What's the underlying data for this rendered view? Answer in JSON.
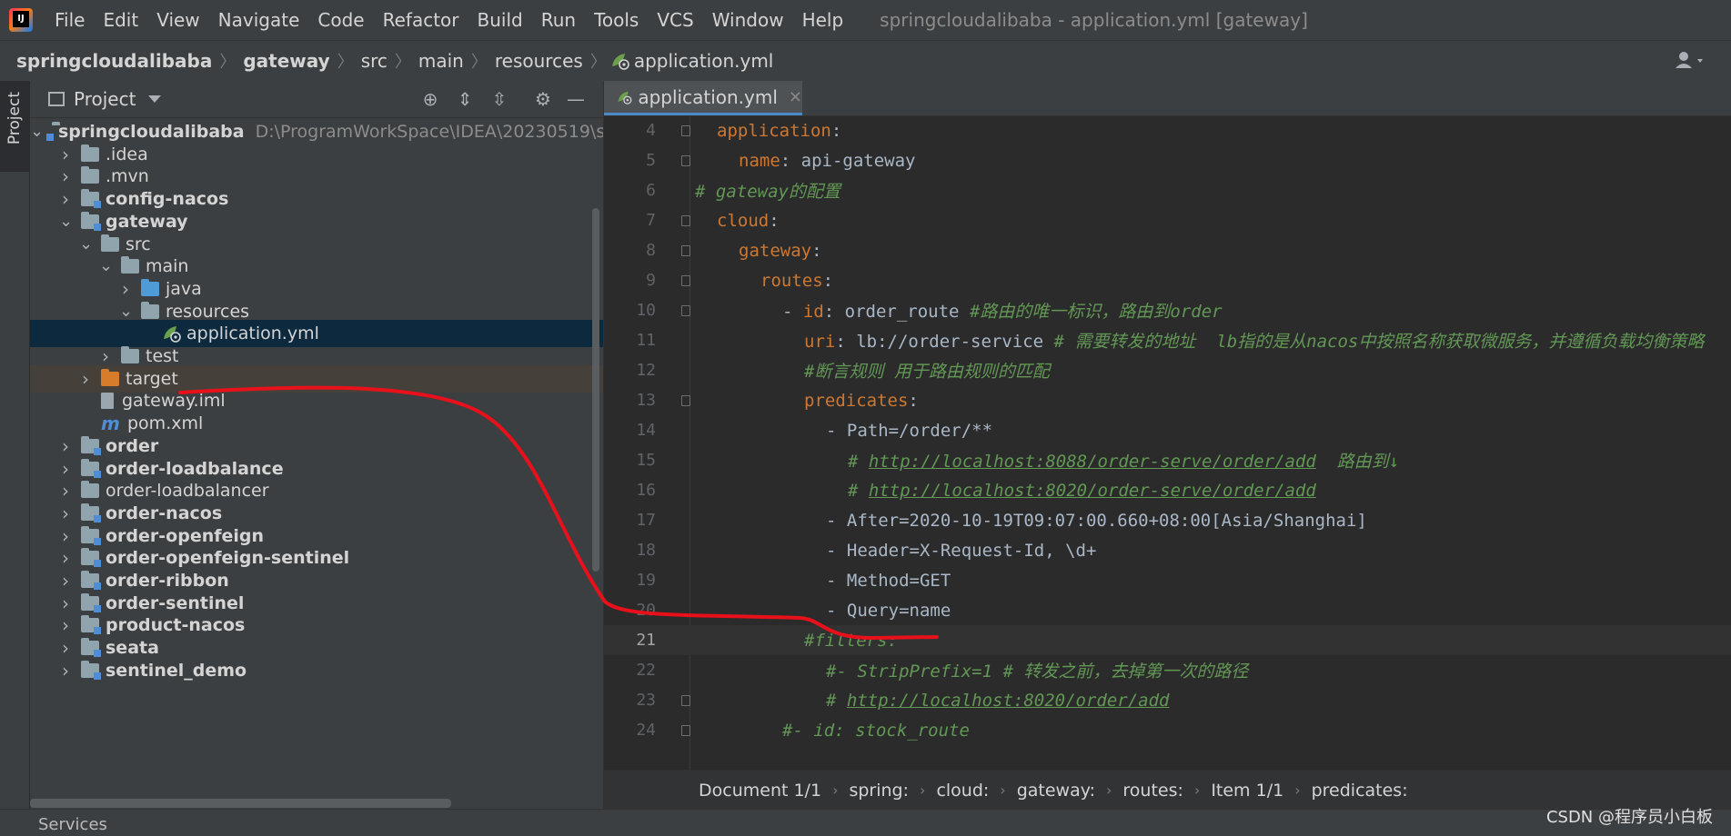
{
  "menubar": {
    "logo_text": "IJ",
    "items": [
      "File",
      "Edit",
      "View",
      "Navigate",
      "Code",
      "Refactor",
      "Build",
      "Run",
      "Tools",
      "VCS",
      "Window",
      "Help"
    ],
    "window_title": "springcloudalibaba - application.yml [gateway]"
  },
  "navbar": {
    "crumbs": [
      "springcloudalibaba",
      "gateway",
      "src",
      "main",
      "resources",
      "application.yml"
    ]
  },
  "left_strip": {
    "project_tab": "Project"
  },
  "project_panel": {
    "title": "Project",
    "tree": [
      {
        "label": "springcloudalibaba",
        "path": "D:\\ProgramWorkSpace\\IDEA\\20230519\\s",
        "bold": true,
        "depth": 0,
        "expanded": true,
        "icon": "module-folder"
      },
      {
        "label": ".idea",
        "bold": false,
        "depth": 1,
        "expanded": false,
        "icon": "folder"
      },
      {
        "label": ".mvn",
        "bold": false,
        "depth": 1,
        "expanded": false,
        "icon": "folder"
      },
      {
        "label": "config-nacos",
        "bold": true,
        "depth": 1,
        "expanded": false,
        "icon": "module-folder"
      },
      {
        "label": "gateway",
        "bold": true,
        "depth": 1,
        "expanded": true,
        "icon": "module-folder"
      },
      {
        "label": "src",
        "bold": false,
        "depth": 2,
        "expanded": true,
        "icon": "folder"
      },
      {
        "label": "main",
        "bold": false,
        "depth": 3,
        "expanded": true,
        "icon": "folder"
      },
      {
        "label": "java",
        "bold": false,
        "depth": 4,
        "expanded": false,
        "icon": "source-folder"
      },
      {
        "label": "resources",
        "bold": false,
        "depth": 4,
        "expanded": true,
        "icon": "resources-folder"
      },
      {
        "label": "application.yml",
        "bold": false,
        "depth": 5,
        "leaf": true,
        "icon": "yaml-file",
        "selected": true
      },
      {
        "label": "test",
        "bold": false,
        "depth": 3,
        "expanded": false,
        "icon": "folder"
      },
      {
        "label": "target",
        "bold": false,
        "depth": 2,
        "expanded": false,
        "icon": "excluded-folder",
        "excluded": true
      },
      {
        "label": "gateway.iml",
        "bold": false,
        "depth": 2,
        "leaf": true,
        "icon": "iml-file"
      },
      {
        "label": "pom.xml",
        "bold": false,
        "depth": 2,
        "leaf": true,
        "icon": "maven-file"
      },
      {
        "label": "order",
        "bold": true,
        "depth": 1,
        "expanded": false,
        "icon": "module-folder"
      },
      {
        "label": "order-loadbalance",
        "bold": true,
        "depth": 1,
        "expanded": false,
        "icon": "module-folder"
      },
      {
        "label": "order-loadbalancer",
        "bold": false,
        "depth": 1,
        "expanded": false,
        "icon": "folder"
      },
      {
        "label": "order-nacos",
        "bold": true,
        "depth": 1,
        "expanded": false,
        "icon": "module-folder"
      },
      {
        "label": "order-openfeign",
        "bold": true,
        "depth": 1,
        "expanded": false,
        "icon": "module-folder"
      },
      {
        "label": "order-openfeign-sentinel",
        "bold": true,
        "depth": 1,
        "expanded": false,
        "icon": "module-folder"
      },
      {
        "label": "order-ribbon",
        "bold": true,
        "depth": 1,
        "expanded": false,
        "icon": "module-folder"
      },
      {
        "label": "order-sentinel",
        "bold": true,
        "depth": 1,
        "expanded": false,
        "icon": "module-folder"
      },
      {
        "label": "product-nacos",
        "bold": true,
        "depth": 1,
        "expanded": false,
        "icon": "module-folder"
      },
      {
        "label": "seata",
        "bold": true,
        "depth": 1,
        "expanded": false,
        "icon": "module-folder"
      },
      {
        "label": "sentinel_demo",
        "bold": true,
        "depth": 1,
        "expanded": false,
        "icon": "module-folder"
      }
    ]
  },
  "editor": {
    "tab_label": "application.yml",
    "tab_close": "×",
    "lines": [
      {
        "n": "4",
        "indent": 1,
        "fold": true,
        "parts": [
          {
            "t": "application",
            "c": "key"
          },
          {
            "t": ":",
            "c": "plain"
          }
        ]
      },
      {
        "n": "5",
        "indent": 2,
        "fold": true,
        "parts": [
          {
            "t": "name",
            "c": "key"
          },
          {
            "t": ": api-gateway",
            "c": "plain"
          }
        ]
      },
      {
        "n": "6",
        "indent": 0,
        "fold": false,
        "parts": [
          {
            "t": "# gateway的配置",
            "c": "comment"
          }
        ]
      },
      {
        "n": "7",
        "indent": 1,
        "fold": true,
        "parts": [
          {
            "t": "cloud",
            "c": "key"
          },
          {
            "t": ":",
            "c": "plain"
          }
        ]
      },
      {
        "n": "8",
        "indent": 2,
        "fold": true,
        "parts": [
          {
            "t": "gateway",
            "c": "key"
          },
          {
            "t": ":",
            "c": "plain"
          }
        ]
      },
      {
        "n": "9",
        "indent": 3,
        "fold": true,
        "parts": [
          {
            "t": "routes",
            "c": "key"
          },
          {
            "t": ":",
            "c": "plain"
          }
        ]
      },
      {
        "n": "10",
        "indent": 4,
        "fold": true,
        "parts": [
          {
            "t": "- ",
            "c": "plain"
          },
          {
            "t": "id",
            "c": "key"
          },
          {
            "t": ": order_route ",
            "c": "plain"
          },
          {
            "t": "#路由的唯一标识，路由到order",
            "c": "comment"
          }
        ]
      },
      {
        "n": "11",
        "indent": 5,
        "fold": false,
        "parts": [
          {
            "t": "uri",
            "c": "key"
          },
          {
            "t": ": lb://order-service ",
            "c": "plain"
          },
          {
            "t": "# 需要转发的地址  lb指的是从nacos中按照名称获取微服务，并遵循负载均衡策略",
            "c": "comment"
          }
        ]
      },
      {
        "n": "12",
        "indent": 5,
        "fold": false,
        "parts": [
          {
            "t": "#断言规则 用于路由规则的匹配",
            "c": "comment"
          }
        ]
      },
      {
        "n": "13",
        "indent": 5,
        "fold": true,
        "parts": [
          {
            "t": "predicates",
            "c": "key"
          },
          {
            "t": ":",
            "c": "plain"
          }
        ]
      },
      {
        "n": "14",
        "indent": 6,
        "fold": false,
        "parts": [
          {
            "t": "- Path=/order/**",
            "c": "plain"
          }
        ]
      },
      {
        "n": "15",
        "indent": 7,
        "fold": false,
        "parts": [
          {
            "t": "# ",
            "c": "comment"
          },
          {
            "t": "http://localhost:8088/order-serve/order/add",
            "c": "link"
          },
          {
            "t": "  路由到↓",
            "c": "comment"
          }
        ]
      },
      {
        "n": "16",
        "indent": 7,
        "fold": false,
        "parts": [
          {
            "t": "# ",
            "c": "comment"
          },
          {
            "t": "http://localhost:8020/order-serve/order/add",
            "c": "link"
          }
        ]
      },
      {
        "n": "17",
        "indent": 6,
        "fold": false,
        "parts": [
          {
            "t": "- After=2020-10-19T09:07:00.660+08:00[Asia/Shanghai]",
            "c": "plain"
          }
        ]
      },
      {
        "n": "18",
        "indent": 6,
        "fold": false,
        "parts": [
          {
            "t": "- Header=X-Request-Id, \\d+",
            "c": "plain"
          }
        ]
      },
      {
        "n": "19",
        "indent": 6,
        "fold": false,
        "parts": [
          {
            "t": "- Method=GET",
            "c": "plain"
          }
        ]
      },
      {
        "n": "20",
        "indent": 6,
        "fold": false,
        "parts": [
          {
            "t": "- Query=name",
            "c": "plain"
          }
        ]
      },
      {
        "n": "21",
        "indent": 5,
        "fold": false,
        "current": true,
        "parts": [
          {
            "t": "#filters:",
            "c": "comment"
          }
        ]
      },
      {
        "n": "22",
        "indent": 6,
        "fold": false,
        "parts": [
          {
            "t": "#- StripPrefix=1 # 转发之前，去掉第一次的路径",
            "c": "comment"
          }
        ]
      },
      {
        "n": "23",
        "indent": 6,
        "fold": true,
        "parts": [
          {
            "t": "# ",
            "c": "comment"
          },
          {
            "t": "http://localhost:8020/order/add",
            "c": "link"
          }
        ]
      },
      {
        "n": "24",
        "indent": 4,
        "fold": true,
        "parts": [
          {
            "t": "#- id: stock_route",
            "c": "comment"
          }
        ]
      }
    ],
    "structure": [
      "Document 1/1",
      "spring:",
      "cloud:",
      "gateway:",
      "routes:",
      "Item 1/1",
      "predicates:"
    ]
  },
  "bottom_bar": {
    "services": "Services"
  },
  "watermark": "CSDN @程序员小白板",
  "colors": {
    "key": "#cc7832",
    "plain": "#a9b7c6",
    "comment": "#629755",
    "annotation": "#e8101a"
  }
}
